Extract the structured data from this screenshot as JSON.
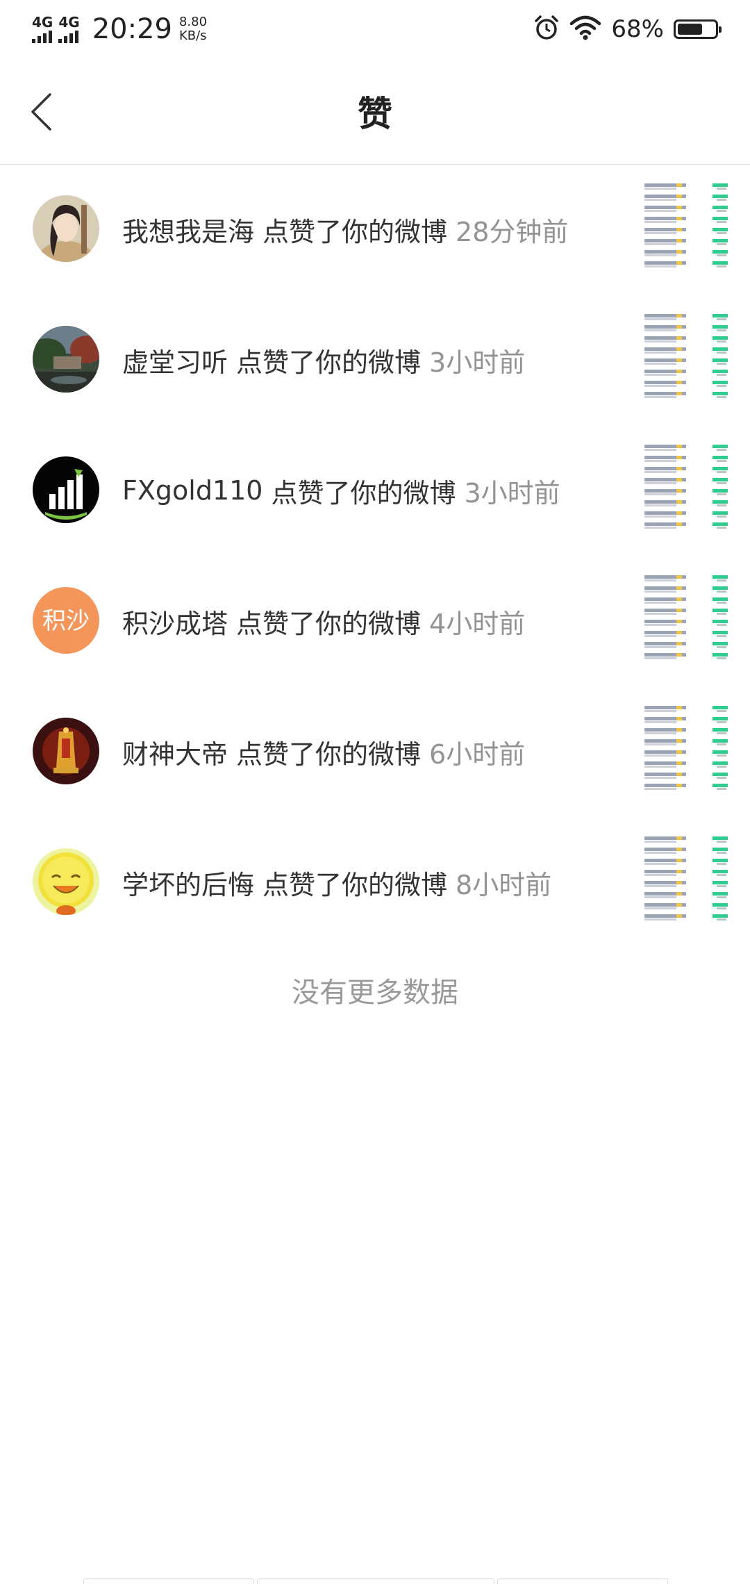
{
  "status_bar": {
    "network_1": "4G",
    "network_2": "4G",
    "time": "20:29",
    "speed_value": "8.80",
    "speed_unit": "KB/s",
    "battery_percent": "68%",
    "battery_level": 0.68,
    "icons": [
      "signal-icon",
      "alarm-icon",
      "wifi-icon",
      "battery-icon"
    ]
  },
  "nav": {
    "title": "赞",
    "back_icon": "chevron-left-icon"
  },
  "likes": [
    {
      "user": "我想我是海",
      "action": "点赞了你的微博",
      "time": "28分钟前",
      "avatar": "anime-girl"
    },
    {
      "user": "虚堂习听",
      "action": "点赞了你的微博",
      "time": "3小时前",
      "avatar": "garden-photo"
    },
    {
      "user": "FXgold110",
      "action": "点赞了你的微博",
      "time": "3小时前",
      "avatar": "bar-chart-logo"
    },
    {
      "user": "积沙成塔",
      "action": "点赞了你的微博",
      "time": "4小时前",
      "avatar": "text-avatar",
      "avatar_text": "积沙",
      "avatar_color": "#f4955a"
    },
    {
      "user": "财神大帝",
      "action": "点赞了你的微博",
      "time": "6小时前",
      "avatar": "fortune-god"
    },
    {
      "user": "学坏的后悔",
      "action": "点赞了你的微博",
      "time": "8小时前",
      "avatar": "smiley-face"
    }
  ],
  "footer": {
    "no_more": "没有更多数据"
  },
  "colors": {
    "text": "#333333",
    "muted": "#939393",
    "divider": "#e4e4e4",
    "accent_green": "#2ecc8f"
  }
}
